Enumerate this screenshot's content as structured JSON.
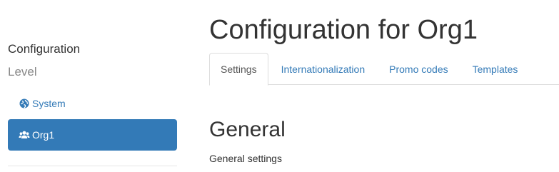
{
  "sidebar": {
    "title": "Configuration",
    "subtitle": "Level",
    "items": [
      {
        "label": "System",
        "icon": "globe-icon",
        "active": false
      },
      {
        "label": "Org1",
        "icon": "users-icon",
        "active": true
      }
    ]
  },
  "main": {
    "title": "Configuration for Org1",
    "tabs": [
      {
        "label": "Settings",
        "active": true
      },
      {
        "label": "Internationalization",
        "active": false
      },
      {
        "label": "Promo codes",
        "active": false
      },
      {
        "label": "Templates",
        "active": false
      }
    ],
    "section": {
      "title": "General",
      "description": "General settings"
    }
  },
  "colors": {
    "accent": "#337ab7",
    "muted": "#888888",
    "text": "#333333",
    "border": "#dddddd"
  }
}
